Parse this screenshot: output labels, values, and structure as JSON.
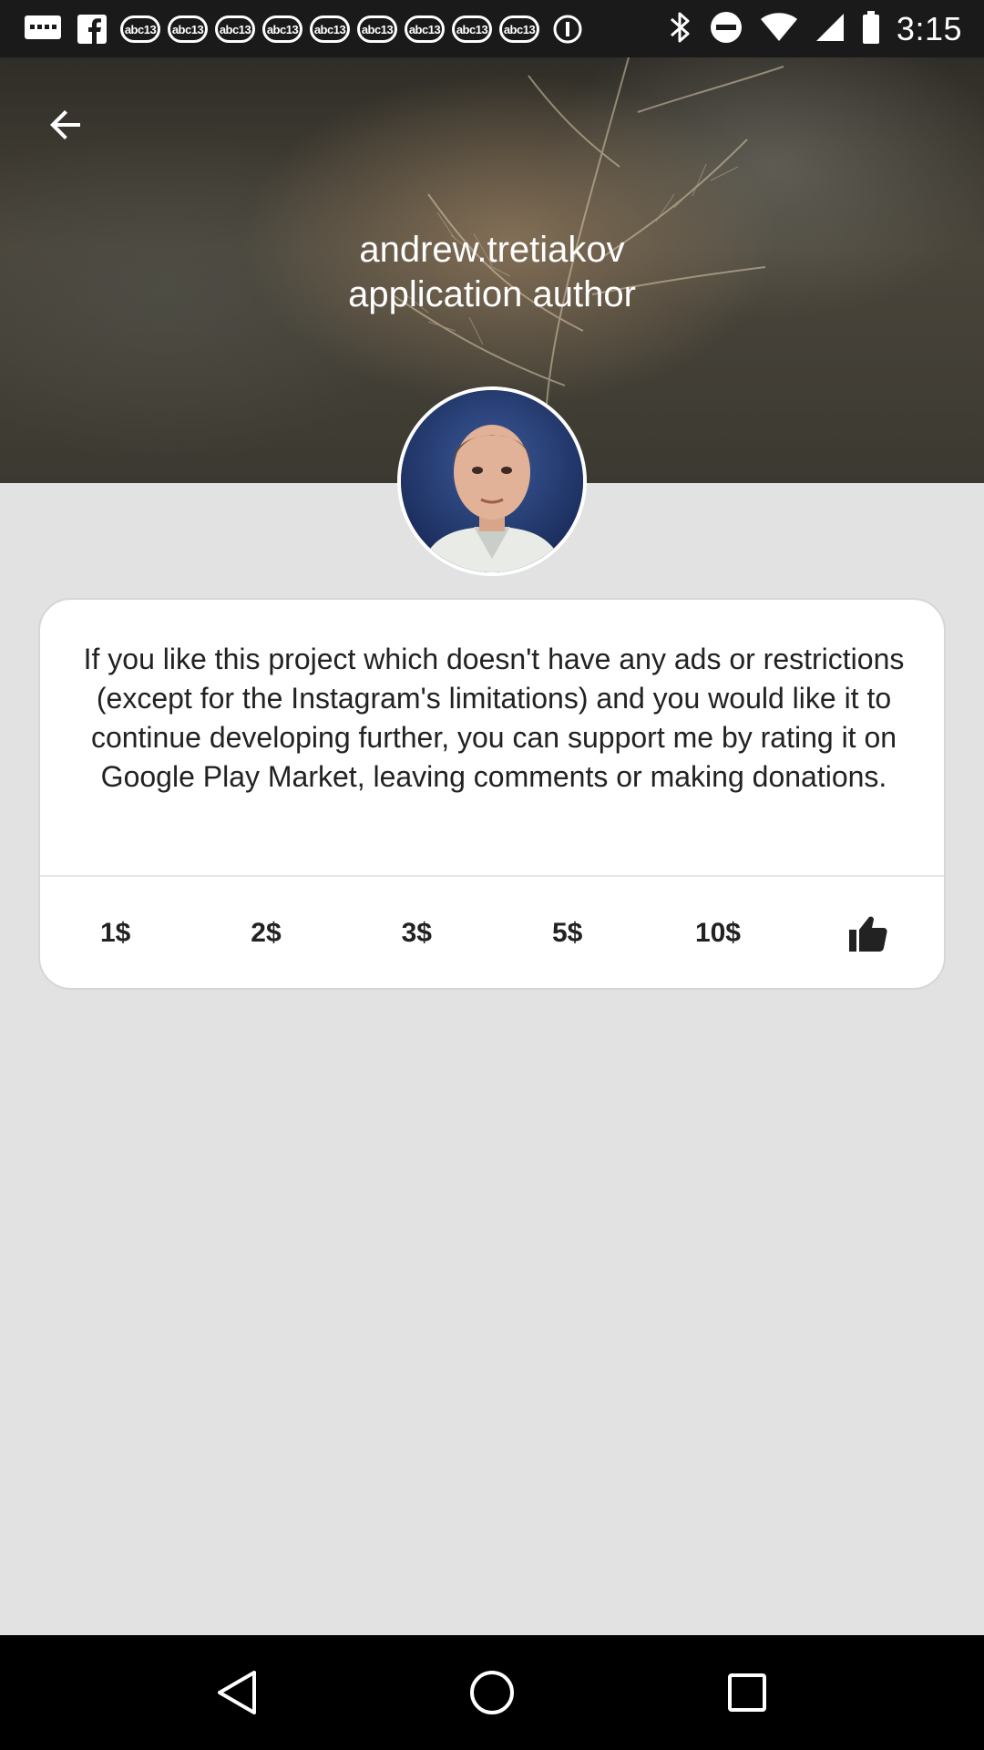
{
  "status_bar": {
    "time": "3:15",
    "badges": [
      "abc13",
      "abc13",
      "abc13",
      "abc13",
      "abc13",
      "abc13",
      "abc13",
      "abc13",
      "abc13"
    ],
    "icons": [
      "message-icon",
      "facebook-icon",
      "circle-i-icon",
      "bluetooth-icon",
      "do-not-disturb-icon",
      "wifi-icon",
      "signal-icon",
      "battery-icon"
    ]
  },
  "header": {
    "author_name": "andrew.tretiakov",
    "author_role": "application author"
  },
  "card": {
    "message": "If you like this project which doesn't have any ads or restrictions (except for the Instagram's limitations) and you would like it to continue developing further, you can support me by rating it on Google Play Market, leaving comments or making donations.",
    "donations": [
      {
        "label": "1$"
      },
      {
        "label": "2$"
      },
      {
        "label": "3$"
      },
      {
        "label": "5$"
      },
      {
        "label": "10$"
      }
    ],
    "like_icon": "thumbs-up-icon"
  },
  "nav_bar": {
    "icons": [
      "back-triangle-icon",
      "home-circle-icon",
      "recents-square-icon"
    ]
  }
}
